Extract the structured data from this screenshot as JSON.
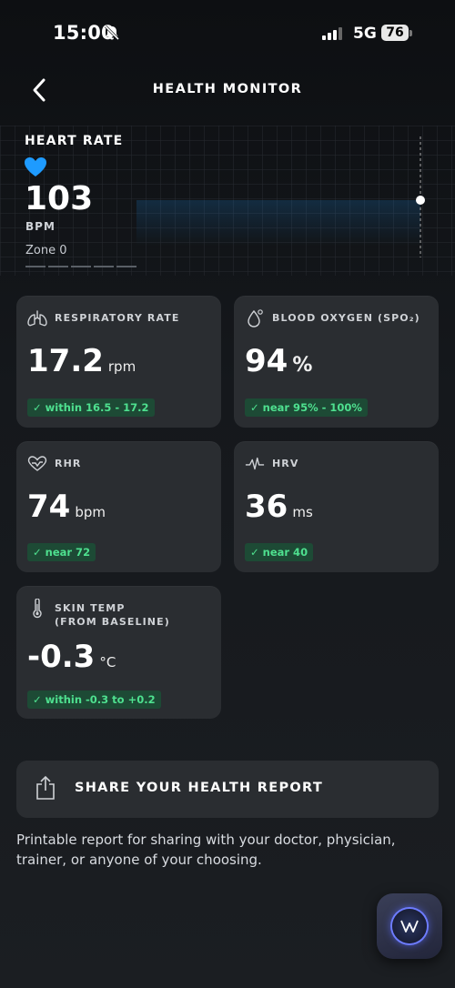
{
  "status_bar": {
    "time": "15:00",
    "network": "5G",
    "battery": "76"
  },
  "nav": {
    "title": "HEALTH MONITOR"
  },
  "heart_rate": {
    "label": "HEART RATE",
    "value": "103",
    "unit": "BPM",
    "zone": "Zone 0"
  },
  "metrics": [
    {
      "id": "respiratory",
      "title": "RESPIRATORY RATE",
      "value": "17.2",
      "unit": "rpm",
      "badge": "✓ within 16.5 - 17.2",
      "icon": "lungs-icon"
    },
    {
      "id": "spo2",
      "title": "BLOOD OXYGEN (SPO₂)",
      "value": "94",
      "unit": "%",
      "badge": "✓ near 95% - 100%",
      "icon": "drop-icon"
    },
    {
      "id": "rhr",
      "title": "RHR",
      "value": "74",
      "unit": "bpm",
      "badge": "✓ near 72",
      "icon": "heart-pulse-icon"
    },
    {
      "id": "hrv",
      "title": "HRV",
      "value": "36",
      "unit": "ms",
      "badge": "✓ near 40",
      "icon": "waveform-icon"
    },
    {
      "id": "skin",
      "title_line1": "SKIN TEMP",
      "title_line2": "(FROM BASELINE)",
      "value": "-0.3",
      "unit": "°C",
      "badge": "✓ within -0.3 to +0.2",
      "icon": "thermometer-icon"
    }
  ],
  "share": {
    "label": "SHARE YOUR HEALTH REPORT",
    "description": "Printable report for sharing with your doctor, physician, trainer, or anyone of your choosing."
  },
  "colors": {
    "accent_blue": "#1e9bff",
    "badge_green": "#4ee08f",
    "card_bg": "#2a2d31"
  }
}
